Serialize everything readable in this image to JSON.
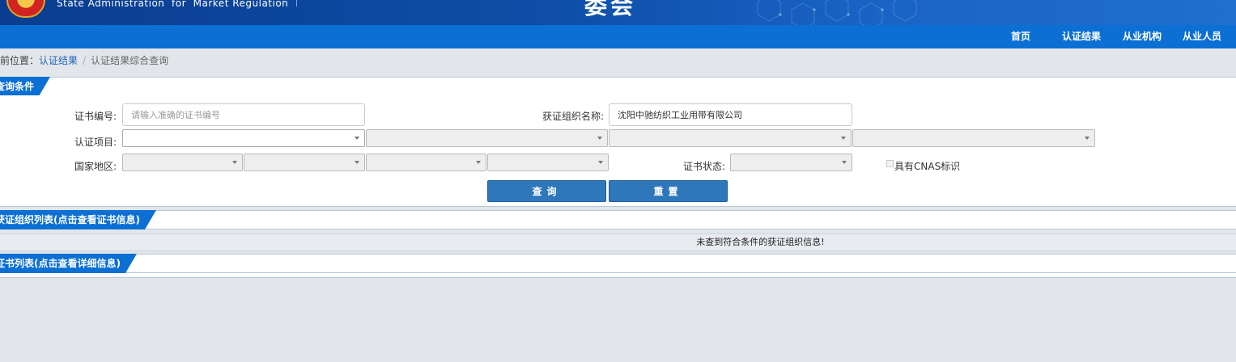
{
  "header": {
    "english_name": "State Administration  for  Market Regulation",
    "title_fragment": "委会"
  },
  "nav": {
    "items": [
      {
        "label": "首页"
      },
      {
        "label": "认证结果"
      },
      {
        "label": "从业机构"
      },
      {
        "label": "从业人员"
      }
    ]
  },
  "breadcrumb": {
    "prefix": "当前位置：",
    "link": "认证结果",
    "separator": "/",
    "current": "认证结果综合查询"
  },
  "query_section": {
    "title": "查询条件",
    "cert_no_label": "证书编号:",
    "cert_no_placeholder": "请输入准确的证书编号",
    "cert_no_value": "",
    "org_name_label": "获证组织名称:",
    "org_name_value": "沈阳中驰纺织工业用带有限公司",
    "project_label": "认证项目:",
    "region_label": "国家地区:",
    "status_label": "证书状态:",
    "cnas_label": "具有CNAS标识",
    "search_button": "查询",
    "reset_button": "重置"
  },
  "org_list": {
    "title": "获证组织列表(点击查看证书信息)",
    "empty_message": "未查到符合条件的获证组织信息!"
  },
  "cert_list": {
    "title": "证书列表(点击查看详细信息)"
  },
  "colors": {
    "nav_blue": "#0b6fd3",
    "button_blue": "#2f77bb",
    "link_blue": "#1f63b4"
  }
}
